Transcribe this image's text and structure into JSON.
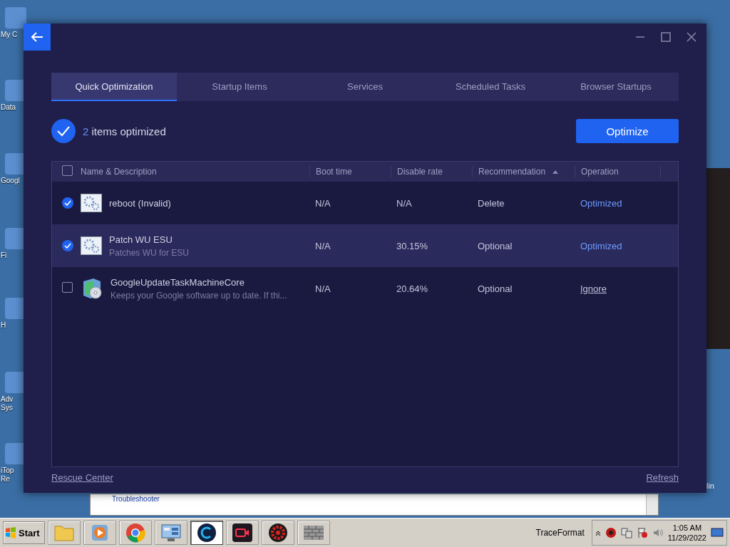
{
  "desktop": {
    "icons": [
      {
        "label": "My C"
      },
      {
        "label": "Data"
      },
      {
        "label": "Googl"
      },
      {
        "label": "Fi"
      },
      {
        "label": "H"
      },
      {
        "label": "Adv Sys"
      },
      {
        "label": "iTop Re"
      }
    ],
    "right_label": "lin",
    "background_window": {
      "text": "Troubleshooter"
    }
  },
  "window": {
    "tabs": [
      {
        "label": "Quick Optimization",
        "selected": true
      },
      {
        "label": "Startup Items",
        "selected": false
      },
      {
        "label": "Services",
        "selected": false
      },
      {
        "label": "Scheduled Tasks",
        "selected": false
      },
      {
        "label": "Browser Startups",
        "selected": false
      }
    ],
    "summary": {
      "count": "2",
      "text": "items optimized"
    },
    "optimize_button": "Optimize",
    "table": {
      "select_all_checked": false,
      "columns": [
        {
          "label": "Name & Description",
          "sorted": false
        },
        {
          "label": "Boot time",
          "sorted": false
        },
        {
          "label": "Disable rate",
          "sorted": false
        },
        {
          "label": "Recommendation",
          "sorted": true
        },
        {
          "label": "Operation",
          "sorted": false
        }
      ],
      "rows": [
        {
          "checked": true,
          "selected": false,
          "kind": "service",
          "name": "reboot (Invalid)",
          "boot_time": "N/A",
          "disable_rate": "N/A",
          "recommendation": "Delete",
          "operation": {
            "kind": "status",
            "label": "Optimized"
          }
        },
        {
          "checked": true,
          "selected": true,
          "kind": "service",
          "name": "Patch WU ESU",
          "description": "Patches WU for ESU",
          "boot_time": "N/A",
          "disable_rate": "30.15%",
          "recommendation": "Optional",
          "operation": {
            "kind": "status",
            "label": "Optimized"
          }
        },
        {
          "checked": false,
          "selected": false,
          "kind": "app",
          "name": "GoogleUpdateTaskMachineCore",
          "description": "Keeps your Google software up to date. If thi...",
          "boot_time": "N/A",
          "disable_rate": "20.64%",
          "recommendation": "Optional",
          "operation": {
            "kind": "link",
            "label": "Ignore"
          }
        }
      ]
    },
    "rescue_link": "Rescue Center",
    "refresh_link": "Refresh"
  },
  "taskbar": {
    "start": "Start",
    "apps": [
      {
        "kind": "folder",
        "active": false
      },
      {
        "kind": "media",
        "active": false
      },
      {
        "kind": "chrome",
        "active": false
      },
      {
        "kind": "panel",
        "active": false
      },
      {
        "kind": "ring",
        "active": true
      },
      {
        "kind": "camera",
        "active": false
      },
      {
        "kind": "gear",
        "active": false
      },
      {
        "kind": "wall",
        "active": false
      }
    ],
    "toolbar": "TraceFormat",
    "clock": {
      "time": "1:05 AM",
      "date": "11/29/2022"
    }
  }
}
